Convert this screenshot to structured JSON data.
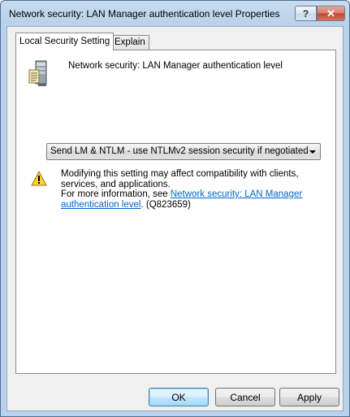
{
  "window": {
    "title": "Network security: LAN Manager authentication level Properties",
    "help_symbol": "?",
    "close_symbol": "✕"
  },
  "tabs": [
    {
      "label": "Local Security Setting",
      "active": true
    },
    {
      "label": "Explain",
      "active": false
    }
  ],
  "policy": {
    "icon": "server-icon",
    "label": "Network security: LAN Manager authentication level"
  },
  "setting": {
    "selected_value": "Send LM & NTLM - use NTLMv2 session security if negotiated"
  },
  "warning": {
    "icon": "warning-icon",
    "text_line1": "Modifying this setting may affect compatibility with clients, services, and applications.",
    "text_prefix": "For more information, see ",
    "link_text": "Network security: LAN Manager authentication level",
    "text_suffix": ". (Q823659)"
  },
  "buttons": {
    "ok": "OK",
    "cancel": "Cancel",
    "apply": "Apply"
  },
  "colors": {
    "link": "#0066cc",
    "title_bar": "#b9d1ea",
    "close_button": "#c4452c"
  }
}
